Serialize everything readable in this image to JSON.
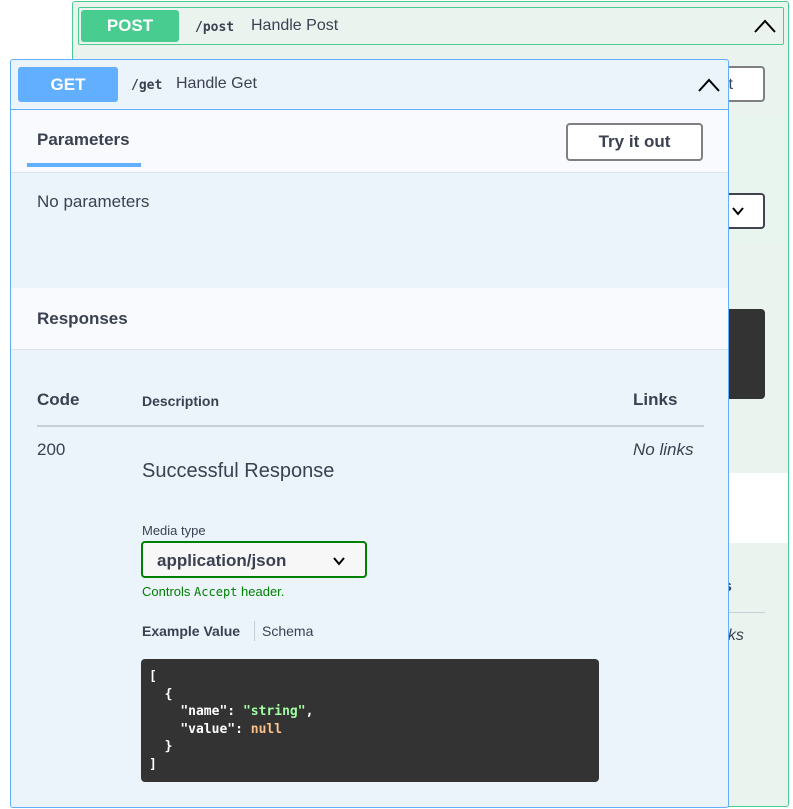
{
  "post_operation": {
    "method": "POST",
    "path": "/post",
    "summary": "Handle Post",
    "try_button_partial": "t",
    "links_header_partial": "s",
    "no_links_partial": "nks"
  },
  "get_operation": {
    "method": "GET",
    "path": "/get",
    "summary": "Handle Get",
    "parameters_tab": "Parameters",
    "try_button": "Try it out",
    "no_parameters": "No parameters",
    "responses_title": "Responses",
    "table_headers": {
      "code": "Code",
      "description": "Description",
      "links": "Links"
    },
    "response": {
      "code": "200",
      "description": "Successful Response",
      "links": "No links",
      "media_type_label": "Media type",
      "media_type_value": "application/json",
      "controls_prefix": "Controls",
      "controls_code": "Accept",
      "controls_suffix": "header.",
      "example_tab": "Example Value",
      "schema_tab": "Schema",
      "example": {
        "open_bracket": "[",
        "open_brace": "{",
        "name_key": "\"name\"",
        "name_value": "\"string\"",
        "value_key": "\"value\"",
        "value_value": "null",
        "close_brace": "}",
        "close_bracket": "]"
      }
    }
  },
  "colors": {
    "get_accent": "#61affe",
    "post_accent": "#49cc90",
    "valid_green": "#008000",
    "code_bg": "#333333"
  },
  "icons": [
    "chevron-up-icon",
    "chevron-down-icon"
  ]
}
